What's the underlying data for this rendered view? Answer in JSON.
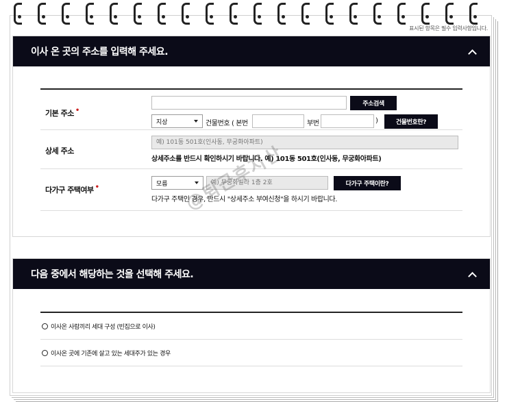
{
  "top_note": "표시된 항목은 필수 입력사항입니다.",
  "section1": {
    "title": "이사 온 곳의 주소를 입력해 주세요.",
    "basic_address": {
      "label": "기본 주소",
      "required_mark": "•",
      "search_button": "주소검색",
      "type_select": "지상",
      "building_no_prefix": "건물번호 ( 본번",
      "sub_label": "부번",
      "close_paren": ")",
      "building_no_button": "건물번호란?"
    },
    "detail_address": {
      "label": "상세 주소",
      "placeholder": "예) 101동 501호(인사동, 무궁화아파트)",
      "note": "상세주소를 반드시 확인하시기 바랍니다. 예) 101동 501호(인사동, 무궁화아파트)"
    },
    "multi_family": {
      "label": "다가구 주택여부",
      "required_mark": "•",
      "select_value": "모름",
      "placeholder": "예) 무궁화빌라 1층 2호",
      "button": "다가구 주택이란?",
      "note": "다가구 주택인 경우, 반드시 \"상세주소 부여신청\"을 하시기 바랍니다."
    }
  },
  "section2": {
    "title": "다음 중에서 해당하는 것을 선택해 주세요.",
    "options": [
      "이사온 사람끼리 세대 구성 (빈집으로 이사)",
      "이사온 곳에 기존에 살고 있는 세대주가 있는 경우"
    ]
  },
  "watermark": "@퇴근후지산"
}
